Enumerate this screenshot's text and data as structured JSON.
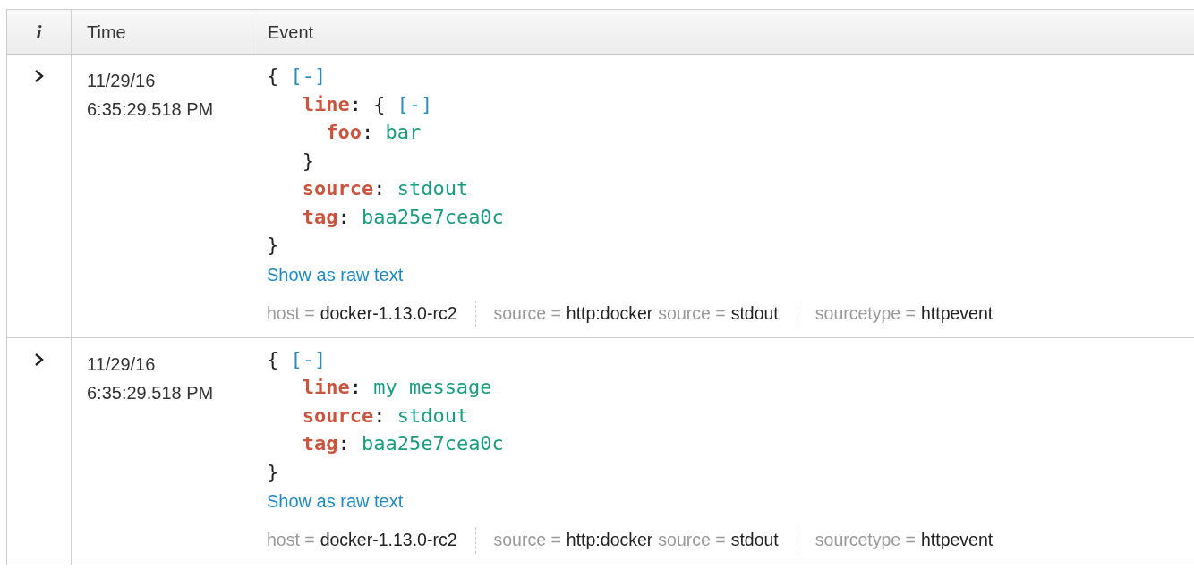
{
  "table": {
    "columns": [
      {
        "kind": "info",
        "label": "i"
      },
      {
        "kind": "text",
        "label": "Time"
      },
      {
        "kind": "text",
        "label": "Event"
      }
    ],
    "rows": [
      {
        "expanded": false,
        "date": "11/29/16",
        "time": "6:35:29.518 PM",
        "event": {
          "open": "{",
          "toggle": "[-]",
          "close": "}",
          "fields": [
            {
              "key": "line",
              "sep": ":",
              "object": {
                "open": "{",
                "toggle": "[-]",
                "close": "}",
                "fields": [
                  {
                    "key": "foo",
                    "sep": ":",
                    "value": "bar"
                  }
                ]
              }
            },
            {
              "key": "source",
              "sep": ":",
              "value": "stdout"
            },
            {
              "key": "tag",
              "sep": ":",
              "value": "baa25e7cea0c"
            }
          ]
        },
        "raw_link": "Show as raw text",
        "meta_groups": [
          [
            {
              "name": "host",
              "eq": "=",
              "value": "docker-1.13.0-rc2"
            }
          ],
          [
            {
              "name": "source",
              "eq": "=",
              "value": "http:docker"
            },
            {
              "name": "source",
              "eq": "=",
              "value": "stdout"
            }
          ],
          [
            {
              "name": "sourcetype",
              "eq": "=",
              "value": "httpevent"
            }
          ]
        ]
      },
      {
        "expanded": false,
        "date": "11/29/16",
        "time": "6:35:29.518 PM",
        "event": {
          "open": "{",
          "toggle": "[-]",
          "close": "}",
          "fields": [
            {
              "key": "line",
              "sep": ":",
              "value": "my message"
            },
            {
              "key": "source",
              "sep": ":",
              "value": "stdout"
            },
            {
              "key": "tag",
              "sep": ":",
              "value": "baa25e7cea0c"
            }
          ]
        },
        "raw_link": "Show as raw text",
        "meta_groups": [
          [
            {
              "name": "host",
              "eq": "=",
              "value": "docker-1.13.0-rc2"
            }
          ],
          [
            {
              "name": "source",
              "eq": "=",
              "value": "http:docker"
            },
            {
              "name": "source",
              "eq": "=",
              "value": "stdout"
            }
          ],
          [
            {
              "name": "sourcetype",
              "eq": "=",
              "value": "httpevent"
            }
          ]
        ]
      }
    ]
  }
}
